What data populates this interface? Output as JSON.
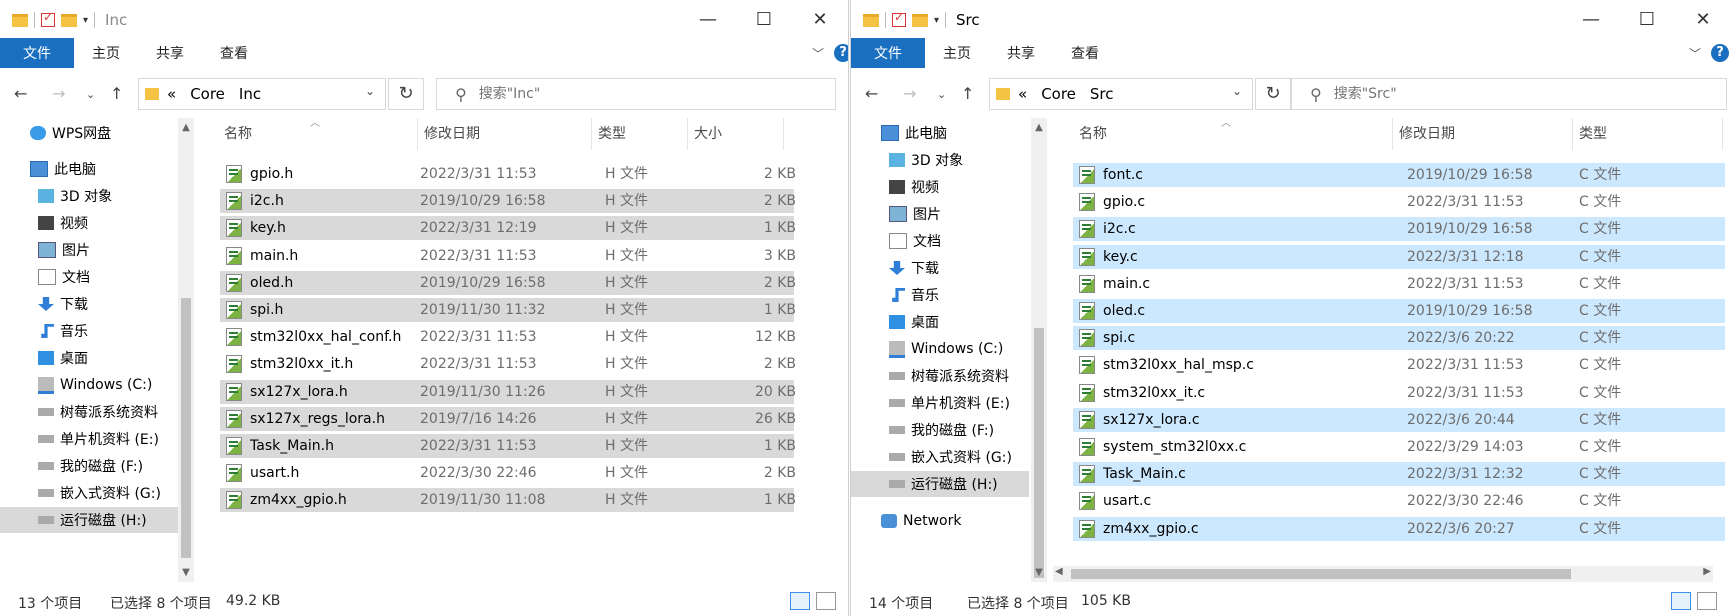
{
  "colors": {
    "accent": "#1a6fc1",
    "selection_gray": "#d9d9d9",
    "selection_blue": "#cce8ff"
  },
  "left": {
    "title": "Inc",
    "ribbon": {
      "file": "文件",
      "home": "主页",
      "share": "共享",
      "view": "查看",
      "help": "?"
    },
    "breadcrumb": [
      "«",
      "Core",
      "Inc"
    ],
    "search_placeholder": "搜索\"Inc\"",
    "nav": [
      {
        "label": "WPS网盘",
        "icon": "cloud-icon"
      },
      {
        "label": "此电脑",
        "icon": "computer-icon"
      },
      {
        "label": "3D 对象",
        "icon": "cube-icon"
      },
      {
        "label": "视频",
        "icon": "video-icon"
      },
      {
        "label": "图片",
        "icon": "picture-icon"
      },
      {
        "label": "文档",
        "icon": "document-icon"
      },
      {
        "label": "下载",
        "icon": "download-icon"
      },
      {
        "label": "音乐",
        "icon": "music-icon"
      },
      {
        "label": "桌面",
        "icon": "desktop-icon"
      },
      {
        "label": "Windows (C:)",
        "icon": "windows-drive-icon"
      },
      {
        "label": "树莓派系统资料",
        "icon": "drive-icon"
      },
      {
        "label": "单片机资料 (E:)",
        "icon": "drive-icon"
      },
      {
        "label": "我的磁盘 (F:)",
        "icon": "drive-icon"
      },
      {
        "label": "嵌入式资料 (G:)",
        "icon": "drive-icon"
      },
      {
        "label": "运行磁盘 (H:)",
        "icon": "drive-icon"
      }
    ],
    "columns": {
      "name": "名称",
      "date": "修改日期",
      "type": "类型",
      "size": "大小"
    },
    "files": [
      {
        "name": "gpio.h",
        "date": "2022/3/31 11:53",
        "type": "H 文件",
        "size": "2 KB",
        "selected": false
      },
      {
        "name": "i2c.h",
        "date": "2019/10/29 16:58",
        "type": "H 文件",
        "size": "2 KB",
        "selected": true
      },
      {
        "name": "key.h",
        "date": "2022/3/31 12:19",
        "type": "H 文件",
        "size": "1 KB",
        "selected": true
      },
      {
        "name": "main.h",
        "date": "2022/3/31 11:53",
        "type": "H 文件",
        "size": "3 KB",
        "selected": false
      },
      {
        "name": "oled.h",
        "date": "2019/10/29 16:58",
        "type": "H 文件",
        "size": "2 KB",
        "selected": true
      },
      {
        "name": "spi.h",
        "date": "2019/11/30 11:32",
        "type": "H 文件",
        "size": "1 KB",
        "selected": true
      },
      {
        "name": "stm32l0xx_hal_conf.h",
        "date": "2022/3/31 11:53",
        "type": "H 文件",
        "size": "12 KB",
        "selected": false
      },
      {
        "name": "stm32l0xx_it.h",
        "date": "2022/3/31 11:53",
        "type": "H 文件",
        "size": "2 KB",
        "selected": false
      },
      {
        "name": "sx127x_lora.h",
        "date": "2019/11/30 11:26",
        "type": "H 文件",
        "size": "20 KB",
        "selected": true
      },
      {
        "name": "sx127x_regs_lora.h",
        "date": "2019/7/16 14:26",
        "type": "H 文件",
        "size": "26 KB",
        "selected": true
      },
      {
        "name": "Task_Main.h",
        "date": "2022/3/31 11:53",
        "type": "H 文件",
        "size": "1 KB",
        "selected": true
      },
      {
        "name": "usart.h",
        "date": "2022/3/30 22:46",
        "type": "H 文件",
        "size": "2 KB",
        "selected": false
      },
      {
        "name": "zm4xx_gpio.h",
        "date": "2019/11/30 11:08",
        "type": "H 文件",
        "size": "1 KB",
        "selected": true
      }
    ],
    "status": {
      "count": "13 个项目",
      "selected": "已选择 8 个项目",
      "size": "49.2 KB"
    }
  },
  "right": {
    "title": "Src",
    "ribbon": {
      "file": "文件",
      "home": "主页",
      "share": "共享",
      "view": "查看",
      "help": "?"
    },
    "breadcrumb": [
      "«",
      "Core",
      "Src"
    ],
    "search_placeholder": "搜索\"Src\"",
    "nav": [
      {
        "label": "此电脑",
        "icon": "computer-icon"
      },
      {
        "label": "3D 对象",
        "icon": "cube-icon"
      },
      {
        "label": "视频",
        "icon": "video-icon"
      },
      {
        "label": "图片",
        "icon": "picture-icon"
      },
      {
        "label": "文档",
        "icon": "document-icon"
      },
      {
        "label": "下载",
        "icon": "download-icon"
      },
      {
        "label": "音乐",
        "icon": "music-icon"
      },
      {
        "label": "桌面",
        "icon": "desktop-icon"
      },
      {
        "label": "Windows (C:)",
        "icon": "windows-drive-icon"
      },
      {
        "label": "树莓派系统资料",
        "icon": "drive-icon"
      },
      {
        "label": "单片机资料 (E:)",
        "icon": "drive-icon"
      },
      {
        "label": "我的磁盘 (F:)",
        "icon": "drive-icon"
      },
      {
        "label": "嵌入式资料 (G:)",
        "icon": "drive-icon"
      },
      {
        "label": "运行磁盘 (H:)",
        "icon": "drive-icon"
      },
      {
        "label": "Network",
        "icon": "network-icon"
      }
    ],
    "columns": {
      "name": "名称",
      "date": "修改日期",
      "type": "类型"
    },
    "files": [
      {
        "name": "font.c",
        "date": "2019/10/29 16:58",
        "type": "C 文件",
        "selected": true
      },
      {
        "name": "gpio.c",
        "date": "2022/3/31 11:53",
        "type": "C 文件",
        "selected": false
      },
      {
        "name": "i2c.c",
        "date": "2019/10/29 16:58",
        "type": "C 文件",
        "selected": true
      },
      {
        "name": "key.c",
        "date": "2022/3/31 12:18",
        "type": "C 文件",
        "selected": true
      },
      {
        "name": "main.c",
        "date": "2022/3/31 11:53",
        "type": "C 文件",
        "selected": false
      },
      {
        "name": "oled.c",
        "date": "2019/10/29 16:58",
        "type": "C 文件",
        "selected": true
      },
      {
        "name": "spi.c",
        "date": "2022/3/6 20:22",
        "type": "C 文件",
        "selected": true
      },
      {
        "name": "stm32l0xx_hal_msp.c",
        "date": "2022/3/31 11:53",
        "type": "C 文件",
        "selected": false
      },
      {
        "name": "stm32l0xx_it.c",
        "date": "2022/3/31 11:53",
        "type": "C 文件",
        "selected": false
      },
      {
        "name": "sx127x_lora.c",
        "date": "2022/3/6 20:44",
        "type": "C 文件",
        "selected": true
      },
      {
        "name": "system_stm32l0xx.c",
        "date": "2022/3/29 14:03",
        "type": "C 文件",
        "selected": false
      },
      {
        "name": "Task_Main.c",
        "date": "2022/3/31 12:32",
        "type": "C 文件",
        "selected": true
      },
      {
        "name": "usart.c",
        "date": "2022/3/30 22:46",
        "type": "C 文件",
        "selected": false
      },
      {
        "name": "zm4xx_gpio.c",
        "date": "2022/3/6 20:27",
        "type": "C 文件",
        "selected": true
      }
    ],
    "status": {
      "count": "14 个项目",
      "selected": "已选择 8 个项目",
      "size": "105 KB"
    }
  }
}
